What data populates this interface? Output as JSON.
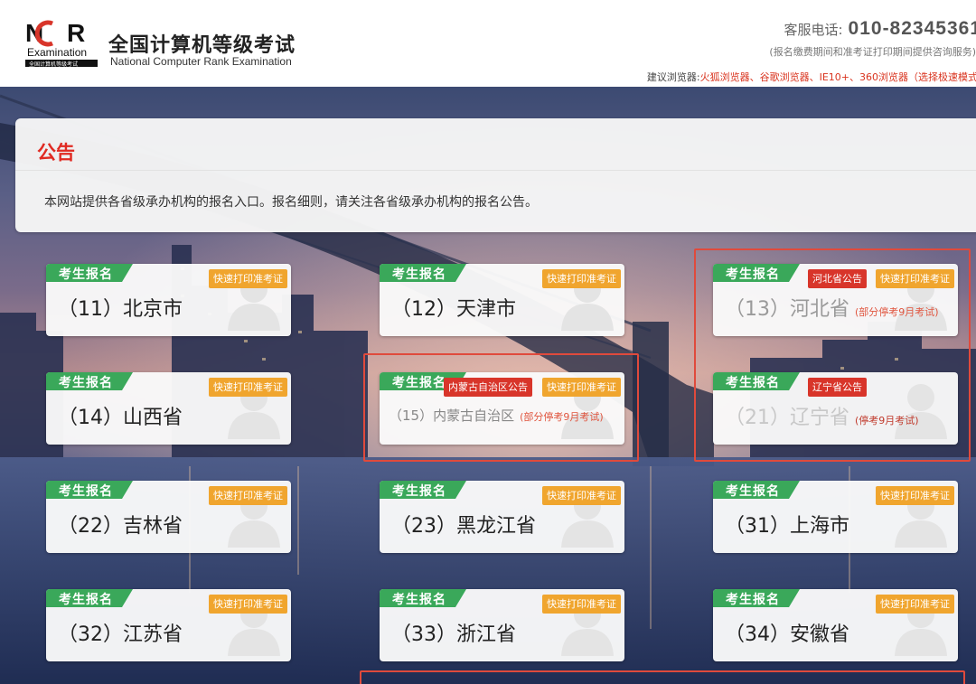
{
  "header": {
    "logo_lettering": "NCR Examination 全国计算机等级考试",
    "title": "全国计算机等级考试",
    "subtitle": "National Computer Rank Examination",
    "phone_label": "客服电话:",
    "phone_number": "010-82345361",
    "phone_note": "(报名缴费期间和准考证打印期间提供咨询服务)",
    "browser_label": "建议浏览器:",
    "browser_list": "火狐浏览器、谷歌浏览器、IE10+、360浏览器（选择极速模式"
  },
  "notice": {
    "title": "公告",
    "body": "本网站提供各省级承办机构的报名入口。报名细则，请关注各省级承办机构的报名公告。"
  },
  "labels": {
    "register": "考生报名",
    "quick_print": "快速打印准考证"
  },
  "cards": {
    "c11": {
      "name": "（11）北京市"
    },
    "c12": {
      "name": "（12）天津市"
    },
    "c13": {
      "name": "（13）河北省",
      "notice_tag": "河北省公告",
      "status": "(部分停考9月考试)"
    },
    "c14": {
      "name": "（14）山西省"
    },
    "c15": {
      "name": "（15）内蒙古自治区",
      "notice_tag": "内蒙古自治区公告",
      "status": "(部分停考9月考试)"
    },
    "c21": {
      "name": "（21）辽宁省",
      "notice_tag": "辽宁省公告",
      "status": "(停考9月考试)"
    },
    "c22": {
      "name": "（22）吉林省"
    },
    "c23": {
      "name": "（23）黑龙江省"
    },
    "c31": {
      "name": "（31）上海市"
    },
    "c32": {
      "name": "（32）江苏省"
    },
    "c33": {
      "name": "（33）浙江省"
    },
    "c34": {
      "name": "（34）安徽省"
    }
  },
  "colors": {
    "accent_red": "#e02a22",
    "badge_green": "#3aa85a",
    "print_tag": "#f0a52e",
    "notice_tag": "#d8352a",
    "highlight_box": "#e04a3c"
  }
}
